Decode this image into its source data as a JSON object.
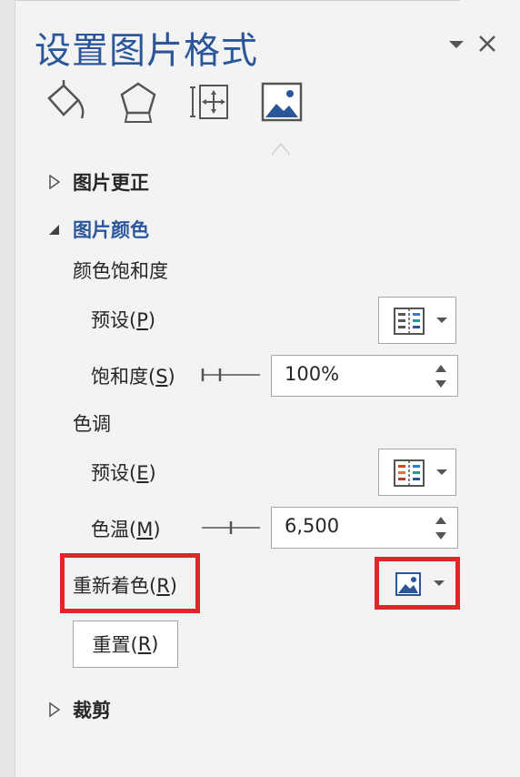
{
  "panel": {
    "title": "设置图片格式",
    "menu_icon": "chevron-down-icon",
    "close_icon": "close-icon",
    "tabs": [
      {
        "icon": "fill-bucket-icon"
      },
      {
        "icon": "pentagon-shape-icon"
      },
      {
        "icon": "size-position-icon"
      },
      {
        "icon": "picture-icon",
        "active": true
      }
    ]
  },
  "sections": {
    "correction": {
      "label": "图片更正",
      "expanded": false
    },
    "color": {
      "label": "图片颜色",
      "expanded": true
    },
    "crop": {
      "label": "裁剪",
      "expanded": false
    }
  },
  "color": {
    "saturation_heading": "颜色饱和度",
    "saturation_preset_label": "预设(",
    "saturation_preset_key": "P",
    "saturation_label": "饱和度(",
    "saturation_key": "S",
    "saturation_value": "100%",
    "tone_heading": "色调",
    "tone_preset_label": "预设(",
    "tone_preset_key": "E",
    "temperature_label": "色温(",
    "temperature_key": "M",
    "temperature_value": "6,500",
    "recolor_label": "重新着色(",
    "recolor_key": "R",
    "reset_label": "重置(",
    "reset_key": "R",
    "close_paren": ")"
  },
  "colors": {
    "accent": "#2b579a",
    "highlight": "#e3242b"
  }
}
